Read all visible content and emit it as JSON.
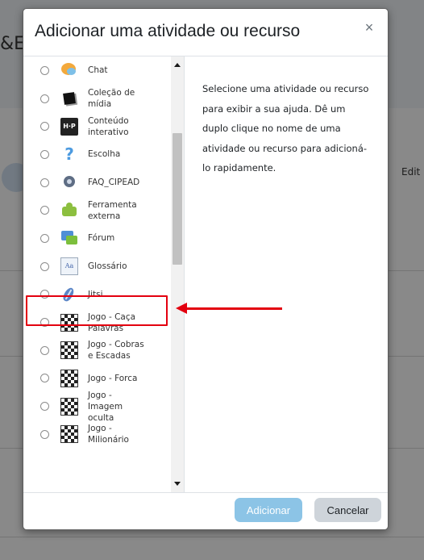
{
  "background": {
    "title_fragment": "&E",
    "side_text_fragment": "Edit"
  },
  "modal": {
    "title": "Adicionar uma atividade ou recurso",
    "close_symbol": "×",
    "options": [
      {
        "label": "Chat",
        "icon": "chat-icon"
      },
      {
        "label": "Coleção de mídia",
        "icon": "media-collection-icon"
      },
      {
        "label": "Conteúdo interativo",
        "icon": "h5p-icon",
        "icon_text": "H·P"
      },
      {
        "label": "Escolha",
        "icon": "question-icon",
        "icon_text": "?"
      },
      {
        "label": "FAQ_CIPEAD",
        "icon": "faq-icon"
      },
      {
        "label": "Ferramenta externa",
        "icon": "puzzle-icon"
      },
      {
        "label": "Fórum",
        "icon": "forum-icon"
      },
      {
        "label": "Glossário",
        "icon": "glossary-icon",
        "icon_text": "Aa"
      },
      {
        "label": "Jitsi",
        "icon": "jitsi-icon"
      },
      {
        "label": "Jogo - Caça Palavras",
        "icon": "game-board-icon"
      },
      {
        "label": "Jogo - Cobras e Escadas",
        "icon": "game-board-icon"
      },
      {
        "label": "Jogo - Forca",
        "icon": "game-board-icon"
      },
      {
        "label": "Jogo - Imagem oculta",
        "icon": "game-board-icon"
      },
      {
        "label": "Jogo - Milionário",
        "icon": "game-board-icon"
      }
    ],
    "help_text": "Selecione uma atividade ou recurso para exibir a sua ajuda. Dê um duplo clique no nome de uma atividade ou recurso para adicioná-lo rapidamente.",
    "add_button": "Adicionar",
    "cancel_button": "Cancelar"
  },
  "annotation": {
    "highlighted_option": "Jitsi",
    "color": "#e3000f"
  },
  "colors": {
    "add_button_bg": "#8cc4e6",
    "cancel_button_bg": "#ced4da"
  }
}
